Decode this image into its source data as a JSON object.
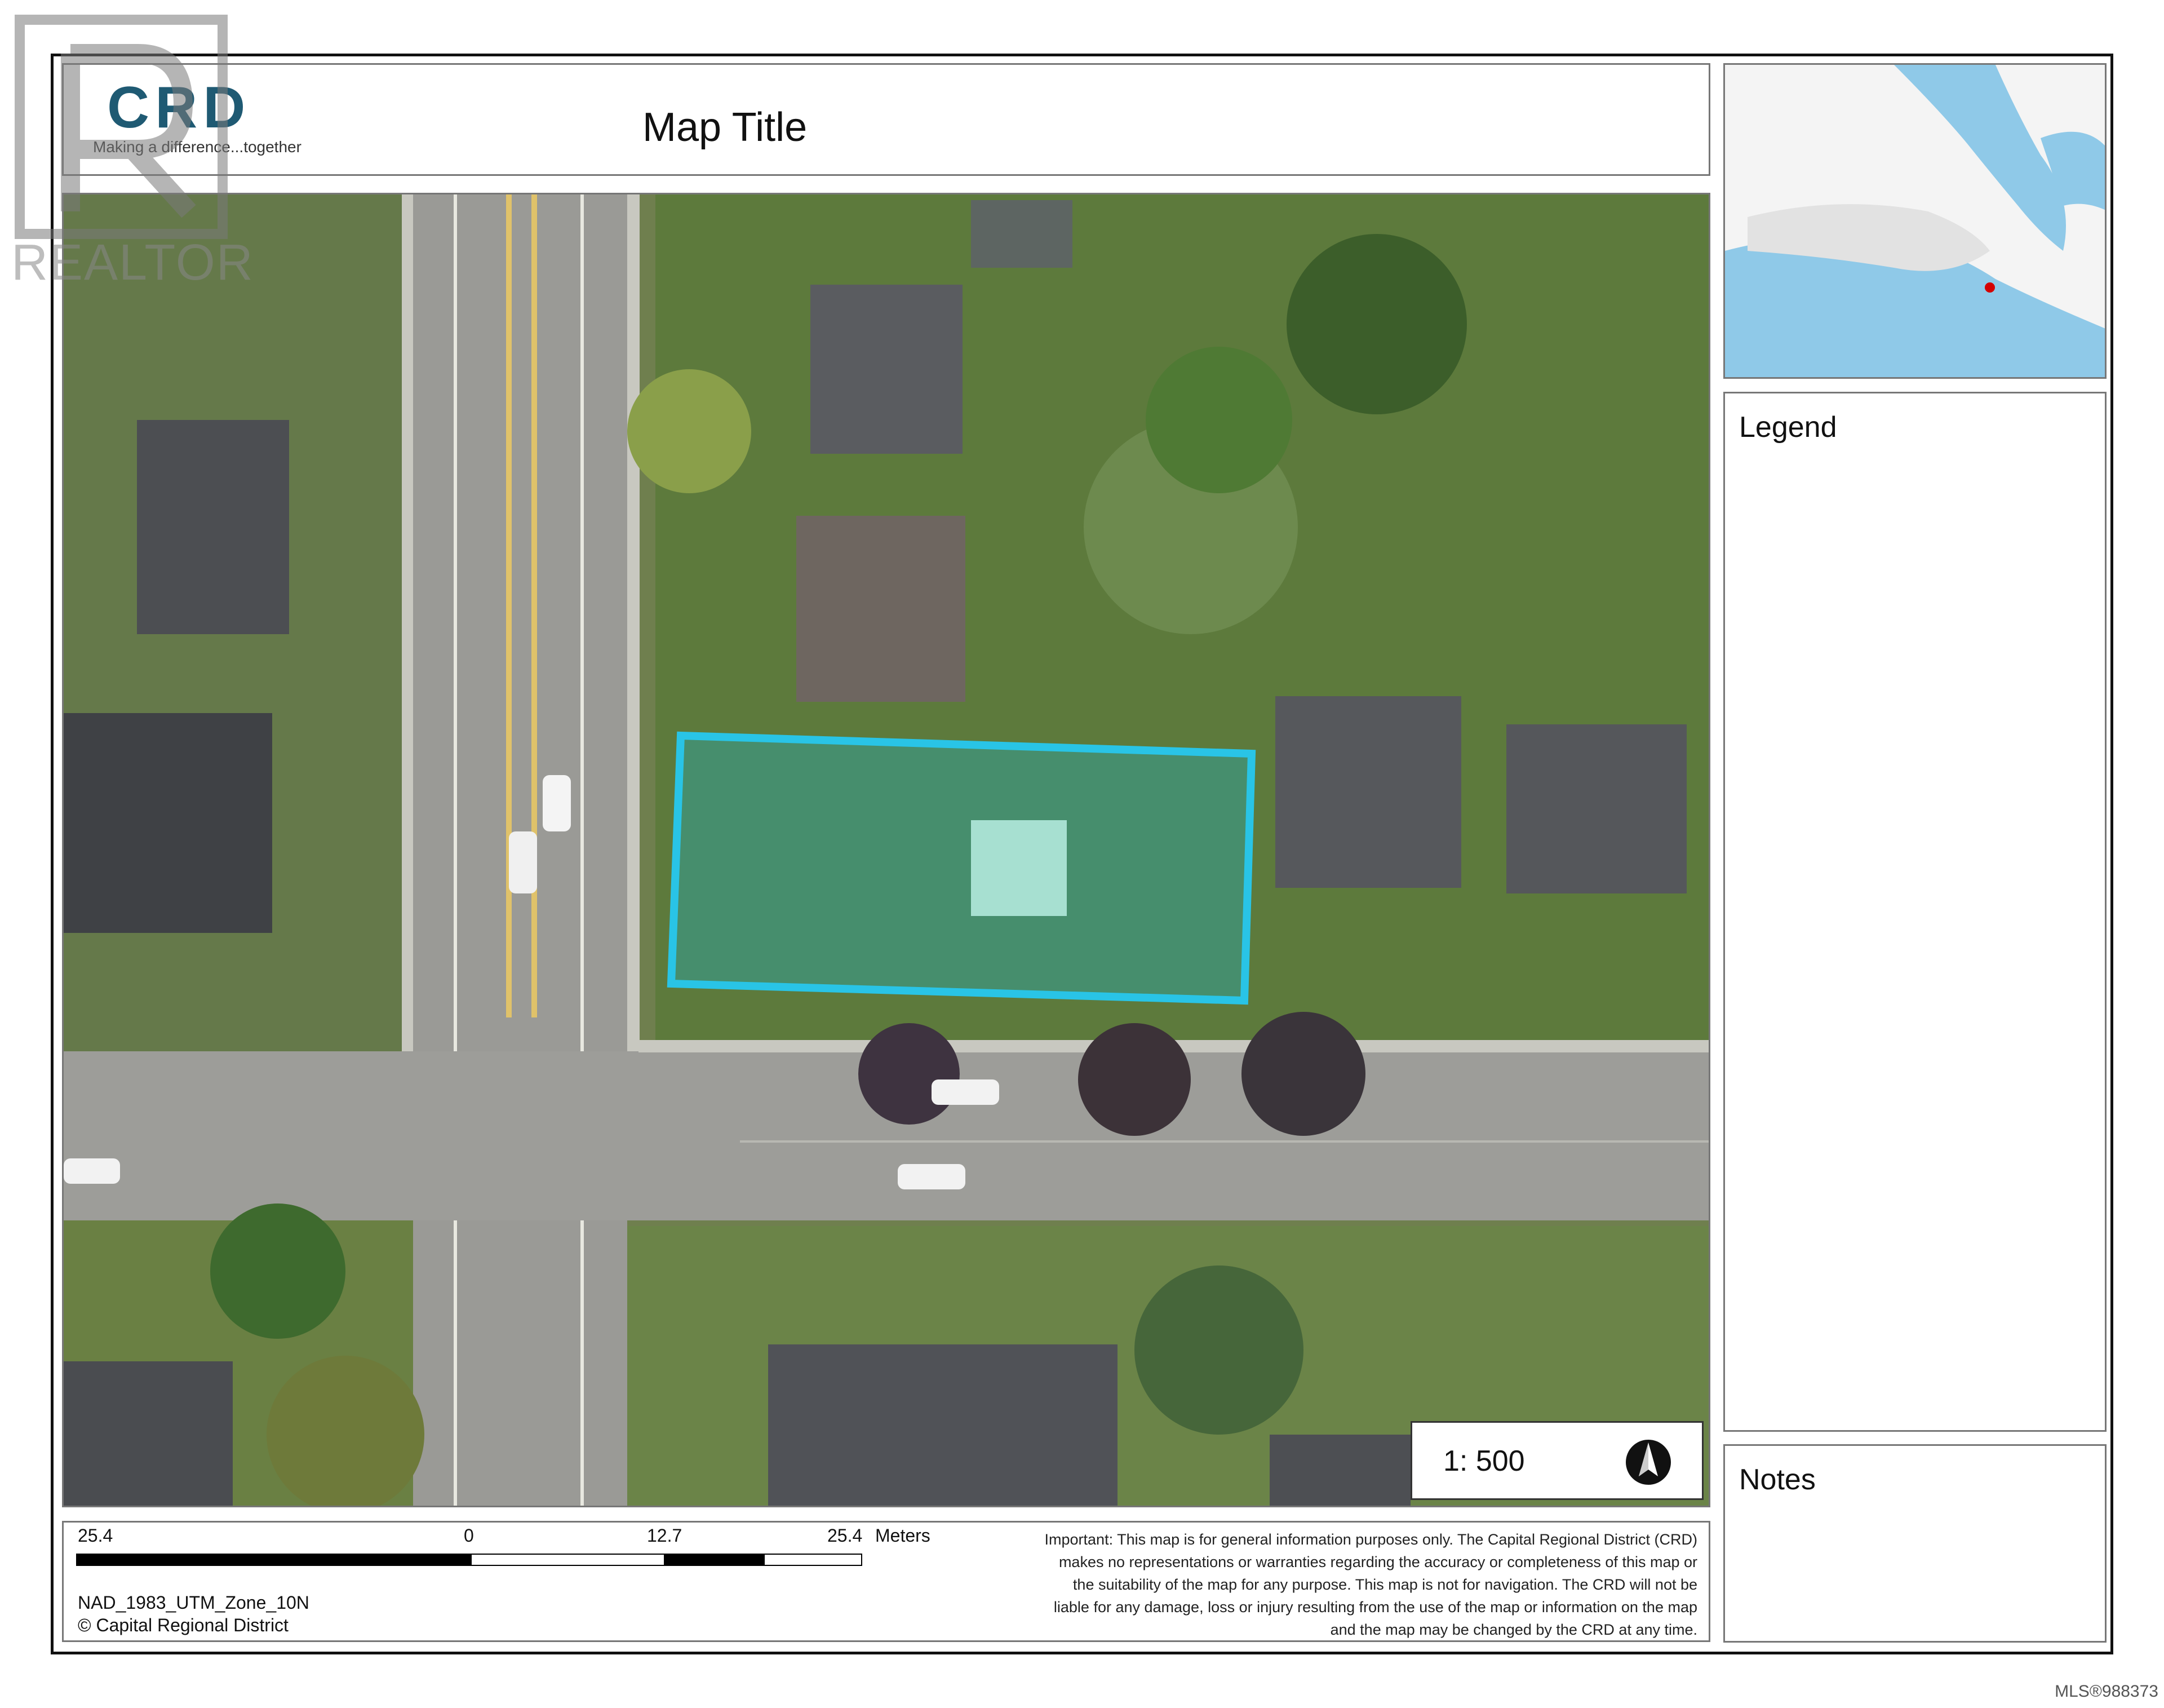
{
  "header": {
    "logo_text": "CRD",
    "tagline": "Making a difference...together",
    "map_title": "Map Title"
  },
  "side": {
    "legend_label": "Legend",
    "notes_label": "Notes"
  },
  "map": {
    "scale_ratio": "1: 500",
    "north_arrow_icon": "north-arrow-icon",
    "highlight_color": "#29c4e6"
  },
  "scale_bar": {
    "ticks": [
      "25.4",
      "0",
      "12.7",
      "25.4"
    ],
    "units": "Meters"
  },
  "footer": {
    "projection": "NAD_1983_UTM_Zone_10N",
    "copyright": "© Capital Regional District",
    "disclaimer": "Important: This map is for general information purposes only. The Capital Regional District (CRD) makes no representations or warranties regarding the accuracy or completeness of this map or the suitability of the map for any purpose. This map is not for navigation. The CRD will not be liable for any damage, loss or injury resulting from the use of the map or information on the map and the map may be changed by the CRD at any time."
  },
  "watermark": {
    "text": "REALTOR",
    "mls": "MLS®988373"
  }
}
